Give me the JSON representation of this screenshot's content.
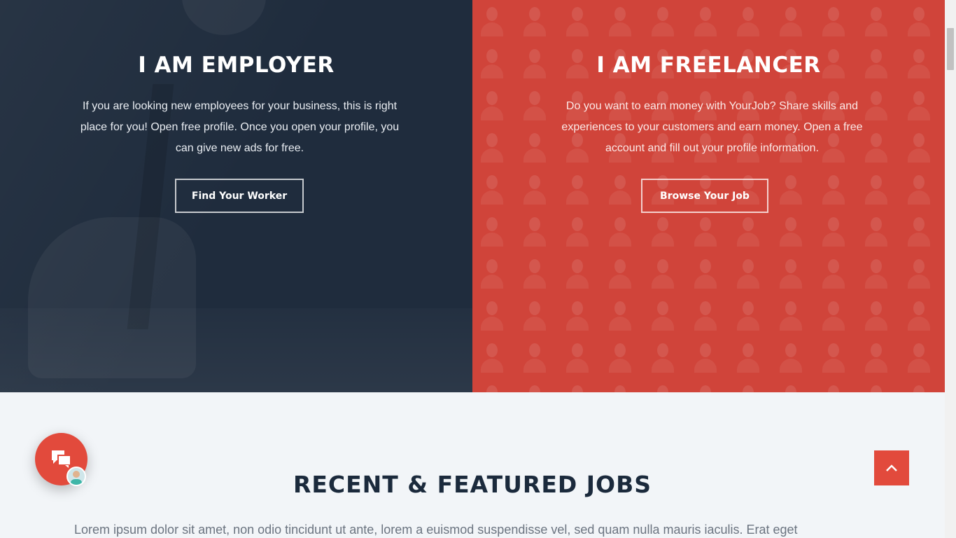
{
  "employer": {
    "title": "I AM EMPLOYER",
    "description": "If you are looking new employees for your business, this is right place for you! Open free profile. Once you open your profile, you can give new ads for free.",
    "button_label": "Find Your Worker",
    "bg_color": "#1f2c3d"
  },
  "freelancer": {
    "title": "I AM FREELANCER",
    "description": "Do you want to earn money with YourJob? Share skills and experiences to your customers and earn money. Open a free account and fill out your profile information.",
    "button_label": "Browse Your Job",
    "bg_color": "#d0443a"
  },
  "jobs_section": {
    "title": "RECENT & FEATURED JOBS",
    "lead": "Lorem ipsum dolor sit amet, non odio tincidunt ut ante, lorem a euismod suspendisse vel, sed quam nulla mauris iaculis. Erat eget"
  },
  "widgets": {
    "chat_icon": "chat-bubbles-icon",
    "scroll_top_icon": "chevron-up-icon",
    "accent_color": "#e24a3c"
  }
}
